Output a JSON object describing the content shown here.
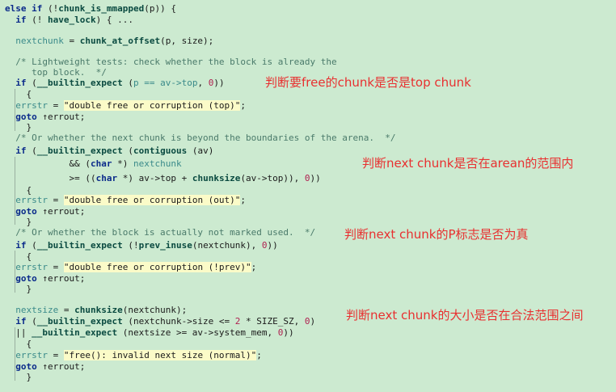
{
  "code": {
    "l1": {
      "kw": "else if",
      "p": " (!",
      "fn": "chunk_is_mmapped",
      "a": "(p)) {"
    },
    "l2": {
      "kw": "if",
      "a": " (! ",
      "fn": "have_lock",
      "b": ") { ..."
    },
    "l3": {
      "id": "nextchunk",
      "a": " = ",
      "fn": "chunk_at_offset",
      "b": "(p, size);"
    },
    "l4": "/* Lightweight tests: check whether the block is already the",
    "l5": "   top block.  */",
    "l6": {
      "kw": "if",
      "a": " (",
      "fn": "__builtin_expect",
      "b": " (",
      "c": "p == av->top",
      "d": ", ",
      "num": "0",
      "e": "))"
    },
    "brace_open": "{",
    "brace_close": "}",
    "errstr": "errstr",
    "assign": " = ",
    "semi": ";",
    "goto_kw": "goto",
    "goto_target": " ↑errout;",
    "str_top": "\"double free or corruption (top)\"",
    "l_c2": "/* Or whether the next chunk is beyond the boundaries of the arena.  */",
    "l_if2": {
      "kw": "if",
      "a": " (",
      "fn": "__builtin_expect",
      "b": " (",
      "fn2": "contiguous",
      "c": " (av)"
    },
    "l_and": {
      "a": "&& (",
      "kw": "char",
      "b": " *) ",
      "id": "nextchunk"
    },
    "l_ge": {
      "a": ">= ((",
      "kw": "char",
      "b": " *) av->top + ",
      "fn": "chunksize",
      "c": "(av->top)), ",
      "num": "0",
      "d": "))"
    },
    "str_out": "\"double free or corruption (out)\"",
    "l_c3": "/* Or whether the block is actually not marked used.  */",
    "l_if3": {
      "kw": "if",
      "a": " (",
      "fn": "__builtin_expect",
      "b": " (!",
      "fn2": "prev_inuse",
      "c": "(nextchunk), ",
      "num": "0",
      "d": "))"
    },
    "str_prev": "\"double free or corruption (!prev)\"",
    "l_ns": {
      "id": "nextsize",
      "a": " = ",
      "fn": "chunksize",
      "b": "(nextchunk);"
    },
    "l_if4": {
      "kw": "if",
      "a": " (",
      "fn": "__builtin_expect",
      "b": " (nextchunk->size <= ",
      "num": "2",
      "c": " * SIZE_SZ, ",
      "num2": "0",
      "d": ")"
    },
    "l_or": {
      "a": "|| ",
      "fn": "__builtin_expect",
      "b": " (nextsize >= av->system_mem, ",
      "num": "0",
      "c": "))"
    },
    "str_size": "\"free(): invalid next size (normal)\""
  },
  "annotations": {
    "a1": "判断要free的chunk是否是top chunk",
    "a2": "判断next chunk是否在arean的范围内",
    "a3": "判断next chunk的P标志是否为真",
    "a4": "判断next chunk的大小是否在合法范围之间"
  },
  "colors": {
    "background": "#ccead0",
    "annotation": "#e83030",
    "string_highlight": "#fbfbc8"
  }
}
